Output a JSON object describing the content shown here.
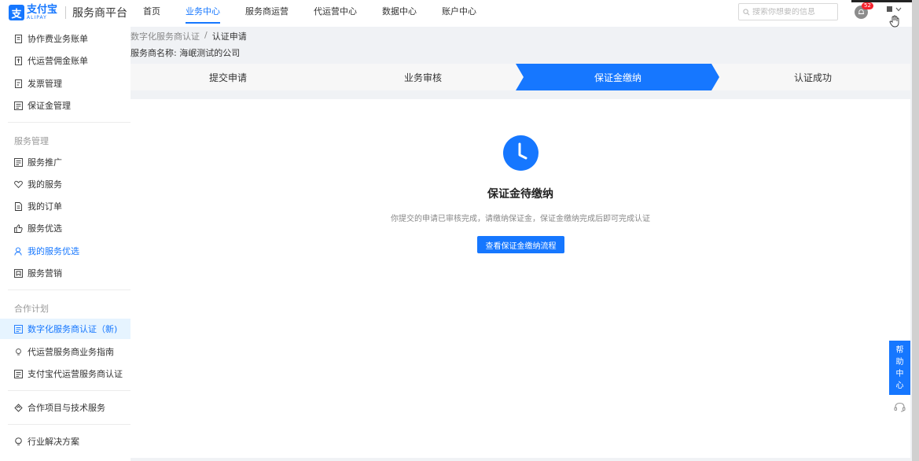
{
  "header": {
    "logo_cn": "支付宝",
    "logo_en": "ALIPAY",
    "platform_name": "服务商平台",
    "nav": [
      {
        "label": "首页",
        "active": false
      },
      {
        "label": "业务中心",
        "active": true
      },
      {
        "label": "服务商运营",
        "active": false
      },
      {
        "label": "代运营中心",
        "active": false
      },
      {
        "label": "数据中心",
        "active": false
      },
      {
        "label": "账户中心",
        "active": false
      }
    ],
    "search_placeholder": "搜索你想要的信息",
    "notification_count": "52"
  },
  "sidebar": {
    "items_top": [
      {
        "label": "协作费业务账单",
        "icon": "bill-icon"
      },
      {
        "label": "代运营佣金账单",
        "icon": "commission-bill-icon"
      },
      {
        "label": "发票管理",
        "icon": "invoice-icon"
      },
      {
        "label": "保证金管理",
        "icon": "deposit-icon"
      }
    ],
    "group_service": "服务管理",
    "items_service": [
      {
        "label": "服务推广",
        "icon": "promotion-icon"
      },
      {
        "label": "我的服务",
        "icon": "heart-icon"
      },
      {
        "label": "我的订单",
        "icon": "order-icon"
      },
      {
        "label": "服务优选",
        "icon": "thumbs-up-icon"
      },
      {
        "label": "我的服务优选",
        "icon": "user-icon"
      },
      {
        "label": "服务营销",
        "icon": "marketing-icon"
      }
    ],
    "group_partner": "合作计划",
    "items_partner": [
      {
        "label": "数字化服务商认证（新)",
        "icon": "certificate-icon",
        "active": true
      },
      {
        "label": "代运营服务商业务指南",
        "icon": "bulb-icon"
      },
      {
        "label": "支付宝代运营服务商认证",
        "icon": "document-icon"
      }
    ],
    "item_coop": {
      "label": "合作项目与技术服务",
      "icon": "diamond-icon"
    },
    "item_solution": {
      "label": "行业解决方案",
      "icon": "lightbulb-icon"
    }
  },
  "breadcrumb": {
    "parent": "数字化服务商认证",
    "separator": "/",
    "current": "认证申请"
  },
  "provider": {
    "label": "服务商名称:",
    "value": "海岷测试的公司"
  },
  "steps": [
    {
      "label": "提交申请",
      "active": false
    },
    {
      "label": "业务审核",
      "active": false
    },
    {
      "label": "保证金缴纳",
      "active": true
    },
    {
      "label": "认证成功",
      "active": false
    }
  ],
  "status": {
    "title": "保证金待缴纳",
    "description": "你提交的申请已审核完成，请缴纳保证金，保证金缴纳完成后即可完成认证",
    "button": "查看保证金缴纳流程"
  },
  "help": {
    "label_chars": [
      "帮",
      "助",
      "中",
      "心"
    ]
  },
  "colors": {
    "primary": "#1677ff",
    "active_bg": "#e6f4ff"
  }
}
